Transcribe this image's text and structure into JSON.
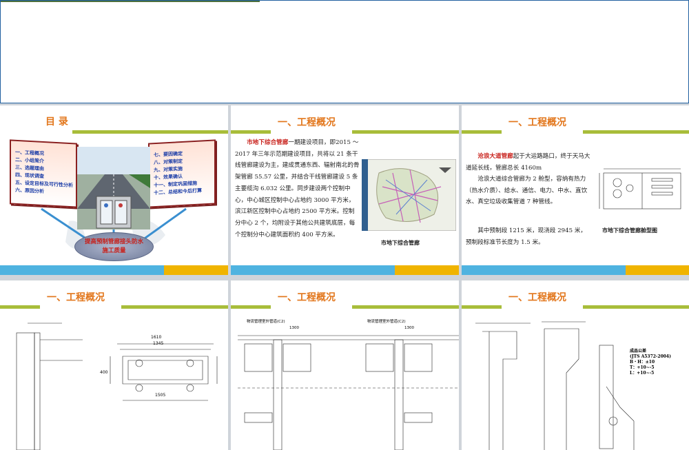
{
  "slide_toc": {
    "title": "目 录",
    "left_items": [
      "一、工程概况",
      "二、小组简介",
      "三、选题理由",
      "四、现状调查",
      "五、设定目标及可行性分析",
      "六、原因分析"
    ],
    "right_items": [
      "七、要因确定",
      "八、对策制定",
      "九、对策实施",
      "十、效果确认",
      "十一、制定巩固措施",
      "十二、总结和今后打算"
    ],
    "center_line1": "提高预制管廊接头防水",
    "center_line2": "施工质量"
  },
  "slide2": {
    "title": "一、工程概况",
    "highlight": "市地下综合管廊",
    "text": "一期建设项目，即2015 ～ 2017 年三年示范期建设项目，共将以 21 条干线管廊建设为主，建成贯通东西、辐射南北的骨架管廊 55.57 公里，并结合干线管廊建设 5 条主要缆沟 6.032 公里。同步建设两个控制中心，中心城区控制中心占地约 3000 平方米，滨江新区控制中心占地约 2500 平方米。控制分中心 2 个，均附设于其他公共建筑底层，每个控制分中心建筑面积约 400 平方米。",
    "map_caption": "市地下综合管廊"
  },
  "slide3": {
    "title": "一、工程概况",
    "highlight": "沧浪大道管廊",
    "text1": "起于大运路路口，终于天马大道延长线，管廊总长 4160m",
    "text2": "沧浪大道综合管廊为 2 舱型，容纳有热力（热水介质）、给水、通信、电力、中水、直饮水、真空垃圾收集管道 7 种管线。",
    "text3": "其中预制段 1215 米，现浇段 2945 米，预制段标准节长度为 1.5 米。",
    "drawing_caption": "市地下综合管廊舱型图"
  },
  "slide4": {
    "title": "一、工程概况",
    "dims": [
      "1610",
      "1345",
      "1505",
      "400"
    ]
  },
  "slide5": {
    "title": "一、工程概况",
    "labels": [
      "物流管理室外管道(C2)",
      "物流管理室外管道(C2)",
      "1300",
      "1300"
    ]
  },
  "slide6": {
    "title": "一、工程概况",
    "spec": [
      "成品公差",
      "(JTS A5372-2004)",
      "B・H：±10",
      "T：+10~-5",
      "L：+10~-5"
    ]
  },
  "colors": {
    "accent_green": "#a8bd3a",
    "title_orange": "#e2761b",
    "footer_blue": "#4fb3e0",
    "footer_yellow": "#f0b400",
    "highlight_red": "#c8201a"
  }
}
